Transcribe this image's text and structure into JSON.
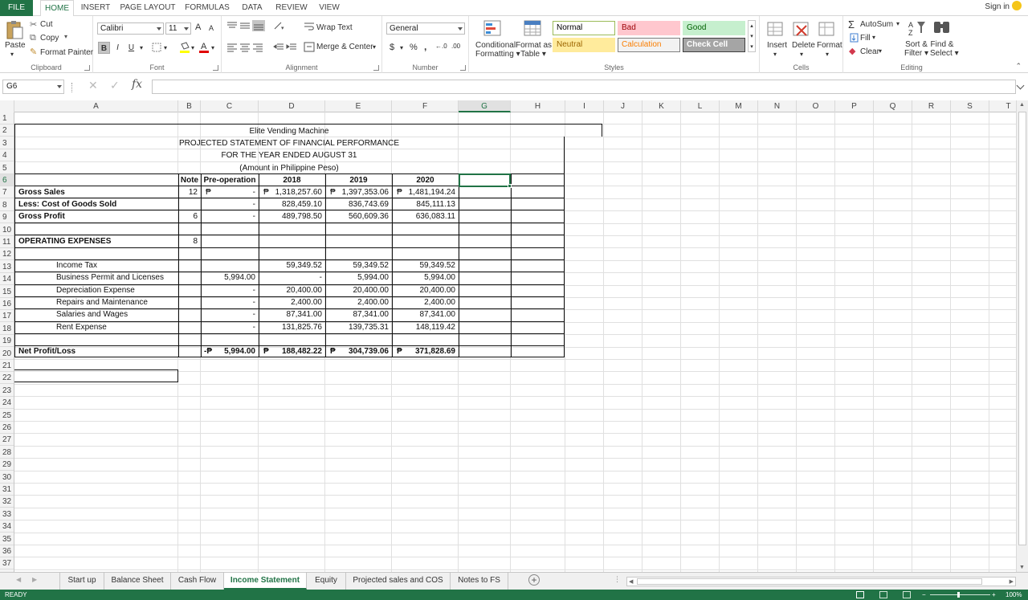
{
  "menu": {
    "file": "FILE",
    "tabs": [
      "HOME",
      "INSERT",
      "PAGE LAYOUT",
      "FORMULAS",
      "DATA",
      "REVIEW",
      "VIEW"
    ],
    "signin": "Sign in"
  },
  "clipboard": {
    "paste": "Paste",
    "cut": "Cut",
    "copy": "Copy",
    "format_painter": "Format Painter",
    "label": "Clipboard"
  },
  "font": {
    "name": "Calibri",
    "size": "11",
    "bold": "B",
    "italic": "I",
    "underline": "U",
    "grow": "A",
    "shrink": "A",
    "label": "Font"
  },
  "alignment": {
    "wrap": "Wrap Text",
    "merge": "Merge & Center",
    "label": "Alignment"
  },
  "number": {
    "format": "General",
    "currency": "$",
    "percent": "%",
    "comma": ",",
    "label": "Number"
  },
  "styles": {
    "conditional": [
      "Conditional",
      "Formatting"
    ],
    "format_table": [
      "Format as",
      "Table"
    ],
    "label": "Styles",
    "cells": [
      {
        "t": "Normal",
        "bg": "#ffffff",
        "fg": "#000000",
        "bd": "#9bbb59"
      },
      {
        "t": "Bad",
        "bg": "#ffc7ce",
        "fg": "#9c0006",
        "bd": "#ffc7ce"
      },
      {
        "t": "Good",
        "bg": "#c6efce",
        "fg": "#006100",
        "bd": "#c6efce"
      },
      {
        "t": "Neutral",
        "bg": "#ffeb9c",
        "fg": "#9c6500",
        "bd": "#ffeb9c"
      },
      {
        "t": "Calculation",
        "bg": "#f2f2f2",
        "fg": "#fa7d00",
        "bd": "#7f7f7f"
      },
      {
        "t": "Check Cell",
        "bg": "#a5a5a5",
        "fg": "#ffffff",
        "bd": "#3f3f3f"
      }
    ]
  },
  "cells_group": {
    "insert": "Insert",
    "delete": "Delete",
    "format": "Format",
    "label": "Cells"
  },
  "editing": {
    "autosum": "AutoSum",
    "fill": "Fill",
    "clear": "Clear",
    "sort": [
      "Sort &",
      "Filter"
    ],
    "find": [
      "Find &",
      "Select"
    ],
    "label": "Editing"
  },
  "namebox": "G6",
  "columns": [
    "A",
    "B",
    "C",
    "D",
    "E",
    "F",
    "G",
    "H",
    "I",
    "J",
    "K",
    "L",
    "M",
    "N",
    "O",
    "P",
    "Q",
    "R",
    "S",
    "T"
  ],
  "rows": [
    "1",
    "2",
    "3",
    "4",
    "5",
    "6",
    "7",
    "8",
    "9",
    "10",
    "11",
    "12",
    "13",
    "14",
    "15",
    "16",
    "17",
    "18",
    "19",
    "20",
    "21",
    "22",
    "23",
    "24",
    "25",
    "26",
    "27",
    "28",
    "29",
    "30",
    "31",
    "32",
    "33",
    "34",
    "35",
    "36",
    "37"
  ],
  "sheet": {
    "title": "Elite Vending Machine",
    "subtitle": "PROJECTED STATEMENT OF FINANCIAL PERFORMANCE",
    "period": "FOR THE YEAR ENDED  AUGUST 31",
    "unit": "(Amount in Philippine Peso)",
    "headers": {
      "note": "Note",
      "preop": "Pre-operation",
      "y1": "2018",
      "y2": "2019",
      "y3": "2020"
    },
    "peso": "₱",
    "gross_sales": {
      "label": "Gross Sales",
      "note": "12",
      "preop": "-",
      "y1": "1,318,257.60",
      "y2": "1,397,353.06",
      "y3": "1,481,194.24"
    },
    "cogs": {
      "label": "Less: Cost of Goods Sold",
      "preop": "-",
      "y1": "828,459.10",
      "y2": "836,743.69",
      "y3": "845,111.13"
    },
    "gross_profit": {
      "label": "Gross Profit",
      "note": "6",
      "preop": "-",
      "y1": "489,798.50",
      "y2": "560,609.36",
      "y3": "636,083.11"
    },
    "opex": {
      "label": "OPERATING EXPENSES",
      "note": "8"
    },
    "expenses": [
      {
        "label": "Income Tax",
        "preop": "",
        "y1": "59,349.52",
        "y2": "59,349.52",
        "y3": "59,349.52"
      },
      {
        "label": "Business Permit and Licenses",
        "preop": "5,994.00",
        "y1": "-",
        "y2": "5,994.00",
        "y3": "5,994.00"
      },
      {
        "label": "Depreciation Expense",
        "preop": "-",
        "y1": "20,400.00",
        "y2": "20,400.00",
        "y3": "20,400.00"
      },
      {
        "label": "Repairs and Maintenance",
        "preop": "-",
        "y1": "2,400.00",
        "y2": "2,400.00",
        "y3": "2,400.00"
      },
      {
        "label": "Salaries and Wages",
        "preop": "-",
        "y1": "87,341.00",
        "y2": "87,341.00",
        "y3": "87,341.00"
      },
      {
        "label": " Rent Expense",
        "preop": "-",
        "y1": "131,825.76",
        "y2": "139,735.31",
        "y3": "148,119.42"
      }
    ],
    "net": {
      "label": "Net Profit/Loss",
      "preop_prefix": "-₱",
      "preop": "5,994.00",
      "y1": "188,482.22",
      "y2": "304,739.06",
      "y3": "371,828.69"
    }
  },
  "sheets": [
    "Start up",
    "Balance Sheet",
    "Cash Flow",
    "Income Statement",
    "Equity",
    "Projected sales and COS",
    "Notes to FS"
  ],
  "active_sheet": "Income Statement",
  "status": {
    "ready": "READY",
    "zoom": "100%"
  }
}
